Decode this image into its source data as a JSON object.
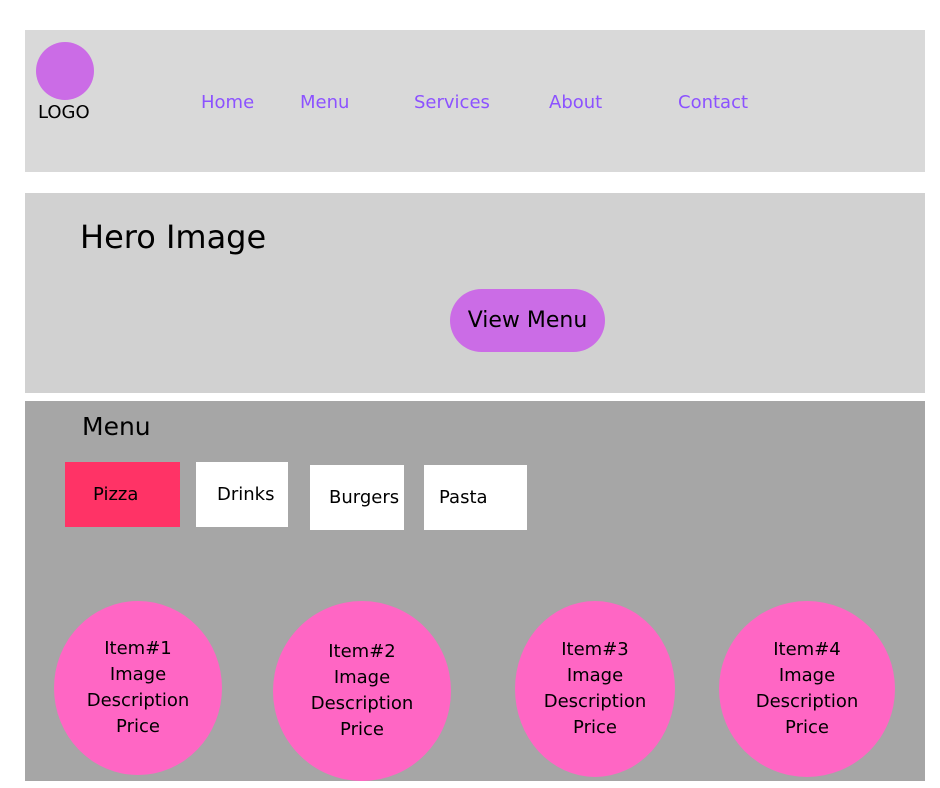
{
  "header": {
    "logo": "LOGO",
    "nav": [
      "Home",
      "Menu",
      "Services",
      "About",
      "Contact"
    ]
  },
  "hero": {
    "title": "Hero Image",
    "button": "View Menu"
  },
  "menu": {
    "title": "Menu",
    "tabs": [
      "Pizza",
      "Drinks",
      "Burgers",
      "Pasta"
    ],
    "items": [
      {
        "name": "Item#1",
        "image": "Image",
        "description": "Description",
        "price": "Price"
      },
      {
        "name": "Item#2",
        "image": "Image",
        "description": "Description",
        "price": "Price"
      },
      {
        "name": "Item#3",
        "image": "Image",
        "description": "Description",
        "price": "Price"
      },
      {
        "name": "Item#4",
        "image": "Image",
        "description": "Description",
        "price": "Price"
      }
    ]
  },
  "colors": {
    "accent_purple": "#cb6ce6",
    "nav_text": "#8c52ff",
    "active_tab": "#ff3366",
    "item_pink": "#ff66c4"
  }
}
